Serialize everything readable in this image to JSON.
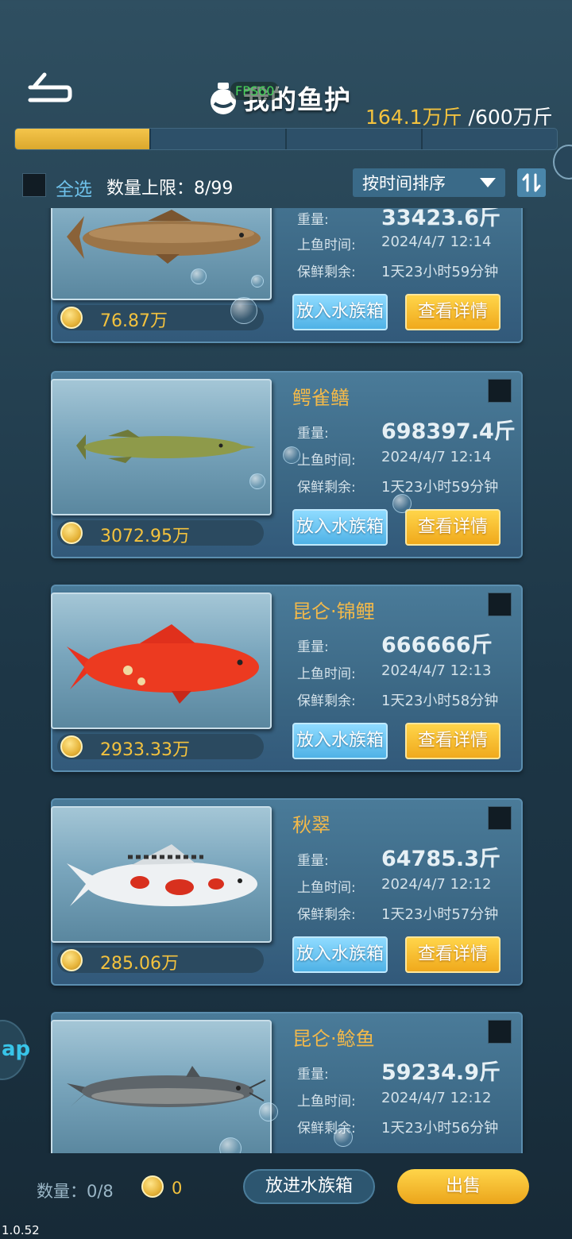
{
  "header": {
    "title": "我的鱼护",
    "fps": "FPS60",
    "capacity_current": "164.1万斤",
    "capacity_max": " /600万斤",
    "progress_fraction": 0.273
  },
  "toolbar": {
    "select_all": "全选",
    "limit_label": "数量上限：8/99",
    "sort_label": "按时间排序"
  },
  "labels": {
    "weight": "重量:",
    "catch_time": "上鱼时间:",
    "fresh_remaining": "保鲜剩余:",
    "aquarium_button": "放入水族箱",
    "detail_button": "查看详情"
  },
  "fish": [
    {
      "name": "",
      "weight": "33423.6斤",
      "time": "2024/4/7  12:14",
      "fresh": "1天23小时59分钟",
      "price": "76.87万",
      "icon": "carp-fish"
    },
    {
      "name": "鳄雀鳝",
      "weight": "698397.4斤",
      "time": "2024/4/7  12:14",
      "fresh": "1天23小时59分钟",
      "price": "3072.95万",
      "icon": "gar-fish"
    },
    {
      "name": "昆仑·锦鲤",
      "weight": "666666斤",
      "time": "2024/4/7  12:13",
      "fresh": "1天23小时58分钟",
      "price": "2933.33万",
      "icon": "red-koi-fish"
    },
    {
      "name": "秋翠",
      "weight": "64785.3斤",
      "time": "2024/4/7  12:12",
      "fresh": "1天23小时57分钟",
      "price": "285.06万",
      "icon": "white-koi-fish"
    },
    {
      "name": "昆仑·鲶鱼",
      "weight": "59234.9斤",
      "time": "2024/4/7  12:12",
      "fresh": "1天23小时56分钟",
      "price": "",
      "icon": "catfish"
    }
  ],
  "side_app": {
    "text": "ap"
  },
  "bottom": {
    "count_label": "数量：0/8",
    "coin_value": "0",
    "put_button": "放进水族箱",
    "sell_button": "出售"
  },
  "version": "1.0.52",
  "colors": {
    "gold": "#f3c23e",
    "aqua": "#6ec1ea",
    "card": "#3b6784"
  }
}
